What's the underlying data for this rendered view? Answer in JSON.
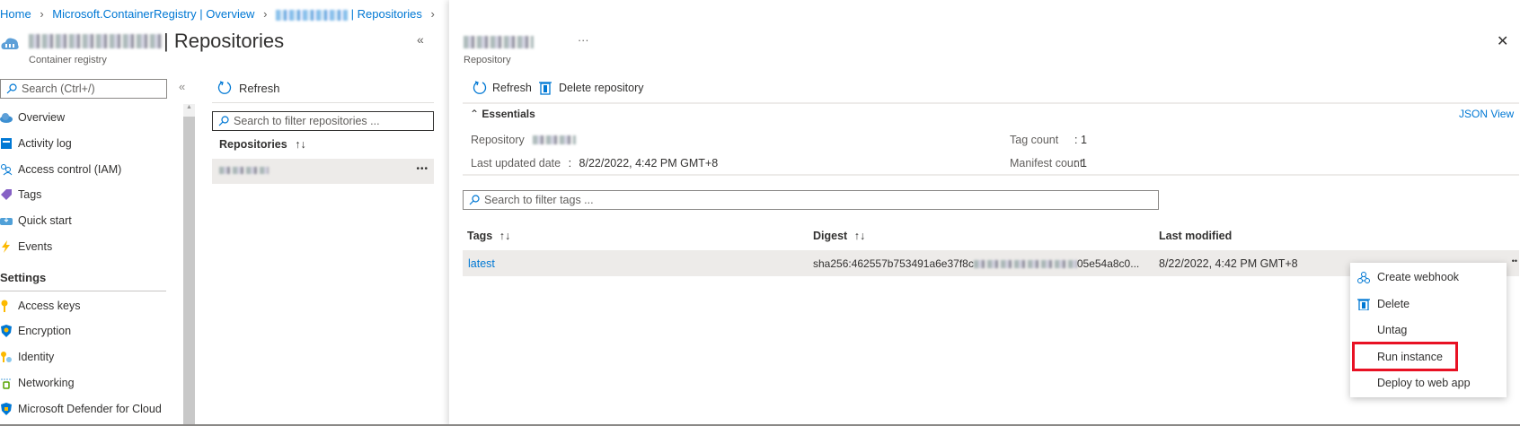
{
  "breadcrumb": [
    "Home",
    "Microsoft.ContainerRegistry | Overview",
    "| Repositories"
  ],
  "blade1": {
    "title": "| Repositories",
    "subtitle": "Container registry",
    "collapse": "«"
  },
  "sidebar": {
    "search_placeholder": "Search (Ctrl+/)",
    "collapse": "«",
    "items": [
      {
        "label": "Overview",
        "icon": "cloud-icon"
      },
      {
        "label": "Activity log",
        "icon": "log-icon"
      },
      {
        "label": "Access control (IAM)",
        "icon": "people-icon"
      },
      {
        "label": "Tags",
        "icon": "tag-icon"
      },
      {
        "label": "Quick start",
        "icon": "quickstart-icon"
      },
      {
        "label": "Events",
        "icon": "lightning-icon"
      }
    ],
    "section": "Settings",
    "settings_items": [
      {
        "label": "Access keys",
        "icon": "key-icon"
      },
      {
        "label": "Encryption",
        "icon": "shield-icon"
      },
      {
        "label": "Identity",
        "icon": "identity-icon"
      },
      {
        "label": "Networking",
        "icon": "network-icon"
      },
      {
        "label": "Microsoft Defender for Cloud",
        "icon": "defender-icon"
      }
    ]
  },
  "repos": {
    "refresh": "Refresh",
    "search_placeholder": "Search to filter repositories ...",
    "column": "Repositories",
    "sort": "↑↓",
    "more": "•••"
  },
  "blade2": {
    "more": "···",
    "subtitle": "Repository",
    "close": "✕",
    "toolbar": {
      "refresh": "Refresh",
      "delete": "Delete repository"
    },
    "essentials": {
      "label": "Essentials",
      "json_view": "JSON View",
      "repository_label": "Repository",
      "last_updated_label": "Last updated date",
      "last_updated_value": "8/22/2022, 4:42 PM GMT+8",
      "tag_count_label": "Tag count",
      "tag_count_value": "1",
      "manifest_count_label": "Manifest count",
      "manifest_count_value": "1",
      "sep": ":"
    },
    "tags_search_placeholder": "Search to filter tags ...",
    "columns": [
      "Tags",
      "Digest",
      "Last modified"
    ],
    "sort": "↑↓",
    "rows": [
      {
        "tag": "latest",
        "digest_start": "sha256:462557b753491a6e37f8c",
        "digest_end": "05e54a8c0...",
        "modified": "8/22/2022, 4:42 PM GMT+8"
      }
    ]
  },
  "context_menu": {
    "items": [
      "Create webhook",
      "Delete",
      "Untag",
      "Run instance",
      "Deploy to web app"
    ],
    "highlight_color": "#e81123"
  }
}
